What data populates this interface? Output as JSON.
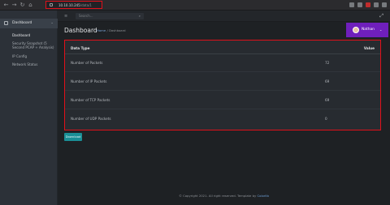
{
  "browser": {
    "url_host": "10.10.10.245",
    "url_path": "/data/1"
  },
  "sidebar": {
    "section": "Dashboard",
    "items": [
      {
        "label": "Dashboard",
        "active": true
      },
      {
        "label": "Security Snapshot (5 Second PCAP + Analysis)",
        "active": false
      },
      {
        "label": "IP Config",
        "active": false
      },
      {
        "label": "Network Status",
        "active": false
      }
    ]
  },
  "topbar": {
    "search_placeholder": "Search..."
  },
  "page": {
    "title": "Dashboard",
    "breadcrumb_home": "Home",
    "breadcrumb_sep": "/",
    "breadcrumb_current": "Dashboard"
  },
  "user": {
    "name": "Nathan"
  },
  "table": {
    "headers": [
      "Data Type",
      "Value"
    ],
    "rows": [
      {
        "type": "Number of Packets",
        "value": "72"
      },
      {
        "type": "Number of IP Packets",
        "value": "69"
      },
      {
        "type": "Number of TCP Packets",
        "value": "69"
      },
      {
        "type": "Number of UDP Packets",
        "value": "0"
      }
    ]
  },
  "download_label": "Download",
  "footer": {
    "text": "© Copyright 2021. All right reserved. Template by",
    "link": "Colorlib"
  },
  "colors": {
    "accent_purple": "#6f1fbc",
    "download_teal": "#1a8f96",
    "highlight_red": "#e0101a"
  }
}
